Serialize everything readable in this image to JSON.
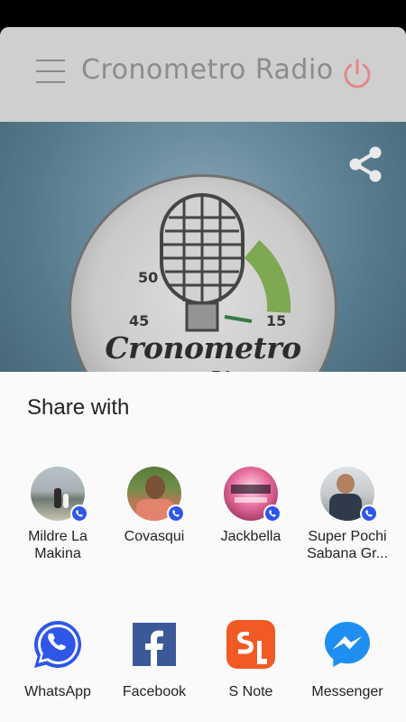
{
  "app": {
    "title": "Cronometro Radio",
    "logo_text": "Cronometro Radio",
    "dial_numbers": [
      "50",
      "45",
      "15"
    ]
  },
  "share_sheet": {
    "title": "Share with",
    "direct_targets": [
      {
        "name": "Mildre La\nMakina",
        "badge": "whatsapp-badge"
      },
      {
        "name": "Covasqui",
        "badge": "whatsapp-badge"
      },
      {
        "name": "Jackbella",
        "badge": "whatsapp-badge"
      },
      {
        "name": "Super Pochi\nSabana Gr...",
        "badge": "whatsapp-badge"
      }
    ],
    "apps": [
      {
        "name": "WhatsApp",
        "icon": "whatsapp-icon",
        "color": "#2e57e8"
      },
      {
        "name": "Facebook",
        "icon": "facebook-icon",
        "color": "#3b5998"
      },
      {
        "name": "S Note",
        "icon": "s-note-icon",
        "color": "#f15a24"
      },
      {
        "name": "Messenger",
        "icon": "messenger-icon",
        "color": "#1f8ef1"
      }
    ],
    "page_indicator": {
      "pages": 4,
      "current": 1
    }
  }
}
